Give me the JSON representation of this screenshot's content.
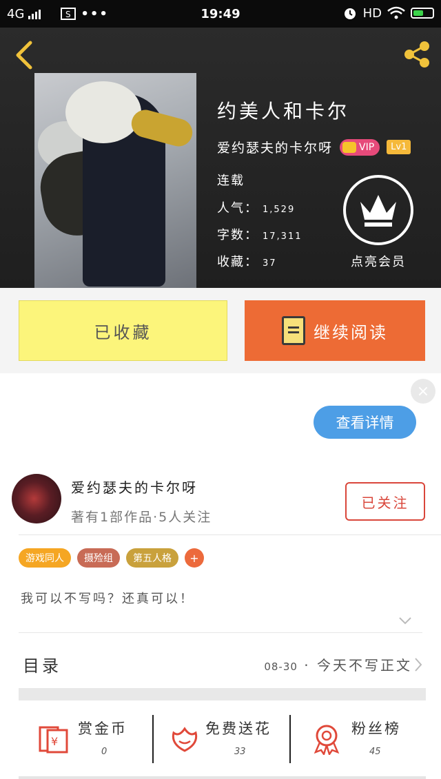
{
  "status_bar": {
    "network": "4G",
    "time": "19:49",
    "hd": "HD"
  },
  "book": {
    "title": "约美人和卡尔",
    "author": "爱约瑟夫的卡尔呀",
    "vip_label": "VIP",
    "level_label": "Lv1",
    "status": "连载",
    "popularity_label": "人气：",
    "popularity": "1,529",
    "word_count_label": "字数：",
    "word_count": "17,311",
    "favorites_label": "收藏：",
    "favorites": "37"
  },
  "member": {
    "label": "点亮会员"
  },
  "actions": {
    "favorited_label": "已收藏",
    "continue_label": "继续阅读"
  },
  "ad": {
    "close_icon": "×",
    "detail_label": "查看详情"
  },
  "author_card": {
    "name": "爱约瑟夫的卡尔呀",
    "meta": "著有1部作品·5人关注",
    "follow_label": "已关注"
  },
  "tags": [
    {
      "label": "游戏同人",
      "color": "#f5a623"
    },
    {
      "label": "摄殓组",
      "color": "#c86b56"
    },
    {
      "label": "第五人格",
      "color": "#c9a13c"
    }
  ],
  "tag_add_label": "+",
  "intro": "我可以不写吗？还真可以！",
  "toc": {
    "title": "目录",
    "latest_date": "08-30",
    "latest_sep": " · ",
    "latest_title": "今天不写正文"
  },
  "rewards": [
    {
      "label": "赏金币",
      "count": "0",
      "icon": "gift-red-envelope-icon"
    },
    {
      "label": "免费送花",
      "count": "33",
      "icon": "flower-icon"
    },
    {
      "label": "粉丝榜",
      "count": "45",
      "icon": "medal-icon"
    }
  ],
  "colors": {
    "accent_orange": "#ed6b35",
    "favorite_yellow": "#fcf57b",
    "follow_red": "#d9463a",
    "detail_blue": "#4d9ee6"
  }
}
